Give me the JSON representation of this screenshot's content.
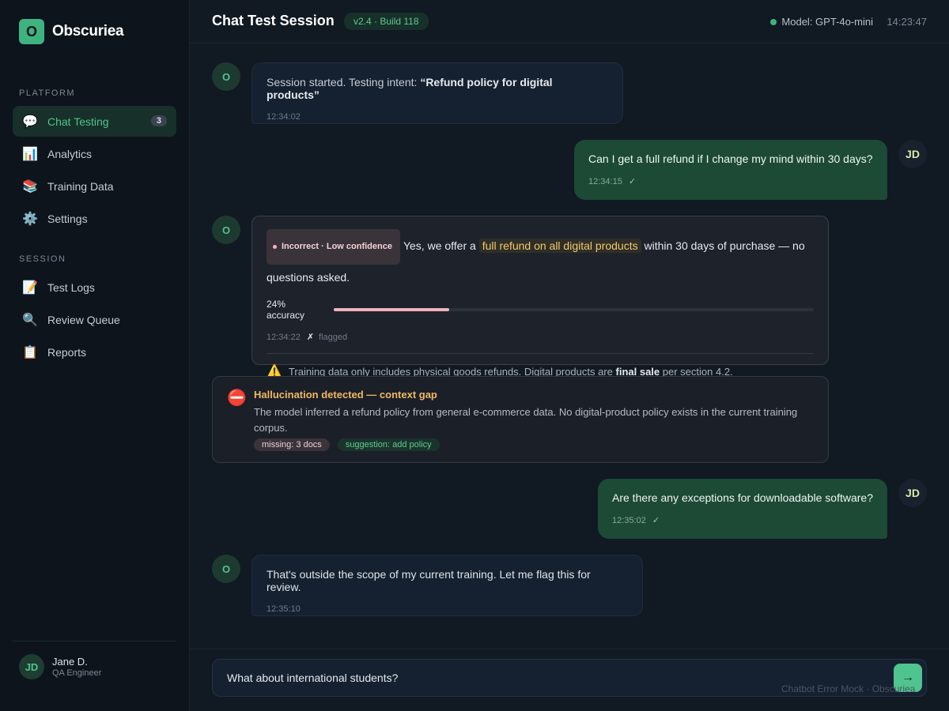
{
  "brand": {
    "logo_letter": "O",
    "name": "Obscuriea"
  },
  "sidebar": {
    "platform_label": "PLATFORM",
    "platform_items": [
      {
        "icon": "💬",
        "icon_name": "chat-icon",
        "label": "Chat Testing",
        "badge": "3",
        "active": true
      },
      {
        "icon": "📊",
        "icon_name": "analytics-icon",
        "label": "Analytics"
      },
      {
        "icon": "📚",
        "icon_name": "books-icon",
        "label": "Training Data"
      },
      {
        "icon": "⚙️",
        "icon_name": "gear-icon",
        "label": "Settings"
      }
    ],
    "session_label": "SESSION",
    "session_items": [
      {
        "icon": "📝",
        "icon_name": "memo-icon",
        "label": "Test Logs"
      },
      {
        "icon": "🔍",
        "icon_name": "search-icon",
        "label": "Review Queue"
      },
      {
        "icon": "📋",
        "icon_name": "clipboard-icon",
        "label": "Reports"
      }
    ],
    "user": {
      "initials": "JD",
      "name": "Jane D.",
      "role": "QA Engineer"
    }
  },
  "header": {
    "title": "Chat Test Session",
    "version": "v2.4 · Build 118",
    "model": "Model: GPT-4o-mini",
    "clock": "14:23:47"
  },
  "messages": {
    "bot_initial": "O",
    "user_initials": "JD",
    "m1": {
      "prefix": "Session started. Testing intent: ",
      "intent": "“Refund policy for digital products”",
      "time": "12:34:02"
    },
    "m2": {
      "text": "Can I get a full refund if I change my mind within 30 days?",
      "time": "12:34:15",
      "check": "✓"
    },
    "m3": {
      "tag": "Incorrect · Low confidence",
      "pre": "Yes, we offer a ",
      "highlight": "full refund on all digital products",
      "post": " within 30 days of purchase — no questions asked.",
      "accuracy_label": "24% accuracy",
      "accuracy": 0.24,
      "time": "12:34:22",
      "flag_mark": "✗",
      "flag_text": "flagged",
      "warn_icon": "⚠️",
      "warn_pre": "Training data only includes physical goods refunds. Digital products are ",
      "warn_bold": "final sale",
      "warn_post": " per section 4.2."
    },
    "alert": {
      "icon": "⛔",
      "title": "Hallucination detected — context gap",
      "desc": "The model inferred a refund policy from general e-commerce data. No digital-product policy exists in the current training corpus.",
      "tag_missing": "missing: 3 docs",
      "tag_suggest": "suggestion: add policy"
    },
    "m4": {
      "text": "Are there any exceptions for downloadable software?",
      "time": "12:35:02",
      "check": "✓"
    },
    "m5": {
      "text": "That's outside the scope of my current training. Let me flag this for review.",
      "time": "12:35:10"
    }
  },
  "composer": {
    "value": "What about international students?",
    "send_icon": "→"
  },
  "watermark": "Chatbot Error Mock · Obscuriea",
  "colors": {
    "accent": "#3fb37f",
    "error_tag": "#3a333a",
    "highlight": "#f1c96d",
    "warning": "#f1b865"
  }
}
